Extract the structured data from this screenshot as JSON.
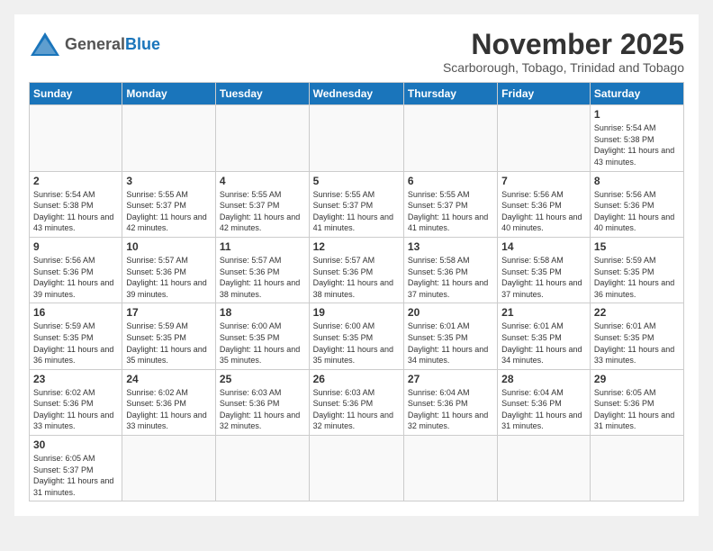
{
  "logo": {
    "line1": "General",
    "line2": "Blue"
  },
  "title": "November 2025",
  "subtitle": "Scarborough, Tobago, Trinidad and Tobago",
  "days_header": [
    "Sunday",
    "Monday",
    "Tuesday",
    "Wednesday",
    "Thursday",
    "Friday",
    "Saturday"
  ],
  "weeks": [
    [
      {
        "day": "",
        "info": ""
      },
      {
        "day": "",
        "info": ""
      },
      {
        "day": "",
        "info": ""
      },
      {
        "day": "",
        "info": ""
      },
      {
        "day": "",
        "info": ""
      },
      {
        "day": "",
        "info": ""
      },
      {
        "day": "1",
        "info": "Sunrise: 5:54 AM\nSunset: 5:38 PM\nDaylight: 11 hours and 43 minutes."
      }
    ],
    [
      {
        "day": "2",
        "info": "Sunrise: 5:54 AM\nSunset: 5:38 PM\nDaylight: 11 hours and 43 minutes."
      },
      {
        "day": "3",
        "info": "Sunrise: 5:55 AM\nSunset: 5:37 PM\nDaylight: 11 hours and 42 minutes."
      },
      {
        "day": "4",
        "info": "Sunrise: 5:55 AM\nSunset: 5:37 PM\nDaylight: 11 hours and 42 minutes."
      },
      {
        "day": "5",
        "info": "Sunrise: 5:55 AM\nSunset: 5:37 PM\nDaylight: 11 hours and 41 minutes."
      },
      {
        "day": "6",
        "info": "Sunrise: 5:55 AM\nSunset: 5:37 PM\nDaylight: 11 hours and 41 minutes."
      },
      {
        "day": "7",
        "info": "Sunrise: 5:56 AM\nSunset: 5:36 PM\nDaylight: 11 hours and 40 minutes."
      },
      {
        "day": "8",
        "info": "Sunrise: 5:56 AM\nSunset: 5:36 PM\nDaylight: 11 hours and 40 minutes."
      }
    ],
    [
      {
        "day": "9",
        "info": "Sunrise: 5:56 AM\nSunset: 5:36 PM\nDaylight: 11 hours and 39 minutes."
      },
      {
        "day": "10",
        "info": "Sunrise: 5:57 AM\nSunset: 5:36 PM\nDaylight: 11 hours and 39 minutes."
      },
      {
        "day": "11",
        "info": "Sunrise: 5:57 AM\nSunset: 5:36 PM\nDaylight: 11 hours and 38 minutes."
      },
      {
        "day": "12",
        "info": "Sunrise: 5:57 AM\nSunset: 5:36 PM\nDaylight: 11 hours and 38 minutes."
      },
      {
        "day": "13",
        "info": "Sunrise: 5:58 AM\nSunset: 5:36 PM\nDaylight: 11 hours and 37 minutes."
      },
      {
        "day": "14",
        "info": "Sunrise: 5:58 AM\nSunset: 5:35 PM\nDaylight: 11 hours and 37 minutes."
      },
      {
        "day": "15",
        "info": "Sunrise: 5:59 AM\nSunset: 5:35 PM\nDaylight: 11 hours and 36 minutes."
      }
    ],
    [
      {
        "day": "16",
        "info": "Sunrise: 5:59 AM\nSunset: 5:35 PM\nDaylight: 11 hours and 36 minutes."
      },
      {
        "day": "17",
        "info": "Sunrise: 5:59 AM\nSunset: 5:35 PM\nDaylight: 11 hours and 35 minutes."
      },
      {
        "day": "18",
        "info": "Sunrise: 6:00 AM\nSunset: 5:35 PM\nDaylight: 11 hours and 35 minutes."
      },
      {
        "day": "19",
        "info": "Sunrise: 6:00 AM\nSunset: 5:35 PM\nDaylight: 11 hours and 35 minutes."
      },
      {
        "day": "20",
        "info": "Sunrise: 6:01 AM\nSunset: 5:35 PM\nDaylight: 11 hours and 34 minutes."
      },
      {
        "day": "21",
        "info": "Sunrise: 6:01 AM\nSunset: 5:35 PM\nDaylight: 11 hours and 34 minutes."
      },
      {
        "day": "22",
        "info": "Sunrise: 6:01 AM\nSunset: 5:35 PM\nDaylight: 11 hours and 33 minutes."
      }
    ],
    [
      {
        "day": "23",
        "info": "Sunrise: 6:02 AM\nSunset: 5:36 PM\nDaylight: 11 hours and 33 minutes."
      },
      {
        "day": "24",
        "info": "Sunrise: 6:02 AM\nSunset: 5:36 PM\nDaylight: 11 hours and 33 minutes."
      },
      {
        "day": "25",
        "info": "Sunrise: 6:03 AM\nSunset: 5:36 PM\nDaylight: 11 hours and 32 minutes."
      },
      {
        "day": "26",
        "info": "Sunrise: 6:03 AM\nSunset: 5:36 PM\nDaylight: 11 hours and 32 minutes."
      },
      {
        "day": "27",
        "info": "Sunrise: 6:04 AM\nSunset: 5:36 PM\nDaylight: 11 hours and 32 minutes."
      },
      {
        "day": "28",
        "info": "Sunrise: 6:04 AM\nSunset: 5:36 PM\nDaylight: 11 hours and 31 minutes."
      },
      {
        "day": "29",
        "info": "Sunrise: 6:05 AM\nSunset: 5:36 PM\nDaylight: 11 hours and 31 minutes."
      }
    ],
    [
      {
        "day": "30",
        "info": "Sunrise: 6:05 AM\nSunset: 5:37 PM\nDaylight: 11 hours and 31 minutes."
      },
      {
        "day": "",
        "info": ""
      },
      {
        "day": "",
        "info": ""
      },
      {
        "day": "",
        "info": ""
      },
      {
        "day": "",
        "info": ""
      },
      {
        "day": "",
        "info": ""
      },
      {
        "day": "",
        "info": ""
      }
    ]
  ]
}
